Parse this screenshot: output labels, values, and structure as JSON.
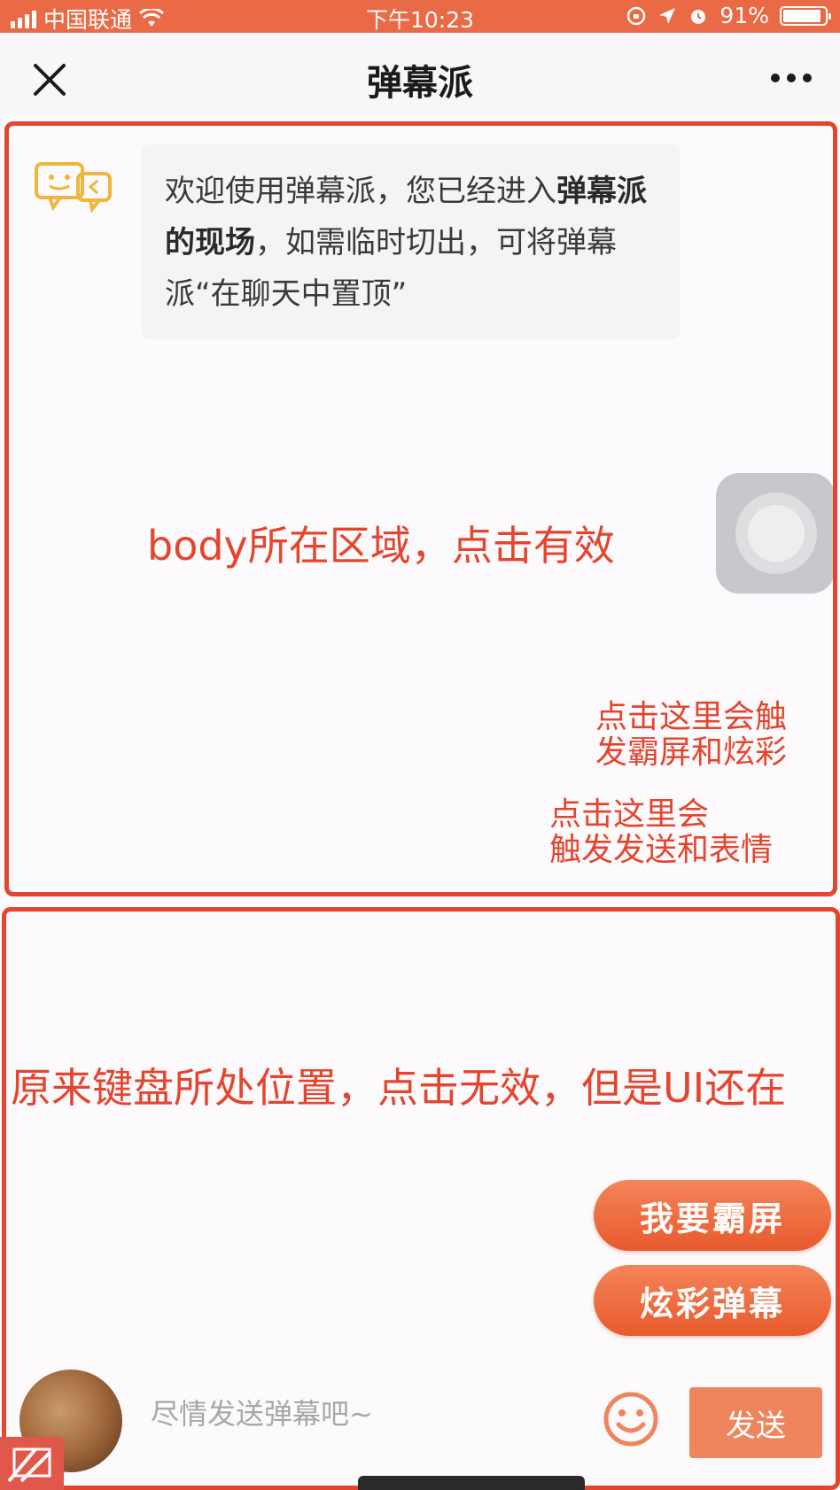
{
  "status_bar": {
    "carrier": "中国联通",
    "time": "下午10:23",
    "battery": "91%"
  },
  "nav": {
    "title": "弹幕派"
  },
  "welcome": {
    "text_part1": "欢迎使用弹幕派，您已经进入",
    "text_bold": "弹幕派的现场",
    "text_part2": "，如需临时切出，可将弹幕派“在聊天中置顶”"
  },
  "annotations": {
    "body_area": "body所在区域，点击有效",
    "right_hint_1_line1": "点击这里会触",
    "right_hint_1_line2": "发霸屏和炫彩",
    "right_hint_2_line1": "点击这里会",
    "right_hint_2_line2": "触发发送和表情",
    "keyboard_area": "原来键盘所处位置，点击无效，但是UI还在"
  },
  "buttons": {
    "bapping": "我要霸屏",
    "colorful": "炫彩弹幕",
    "send": "发送"
  },
  "input": {
    "placeholder": "尽情发送弹幕吧~"
  },
  "colors": {
    "accent": "#ea6a45",
    "annotation": "#e4452f"
  }
}
